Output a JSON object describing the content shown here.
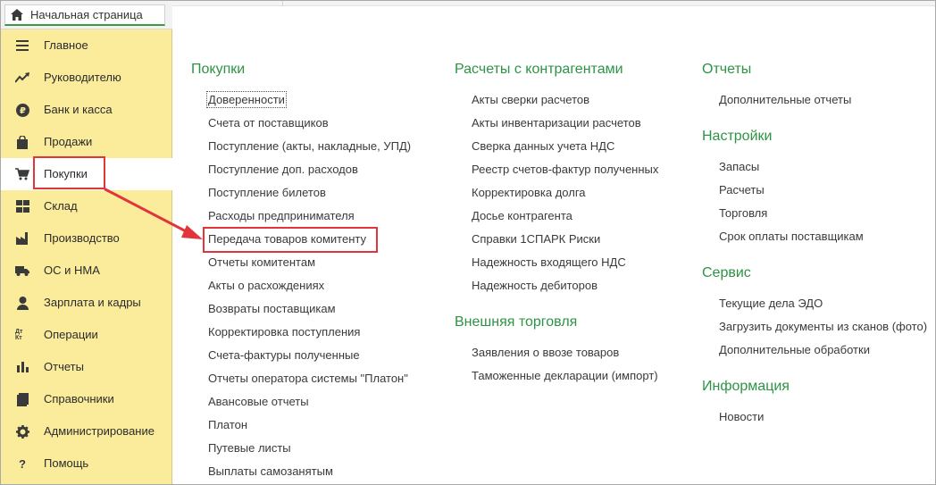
{
  "home_tab": {
    "label": "Начальная страница"
  },
  "sidebar": {
    "items": [
      {
        "label": "Главное"
      },
      {
        "label": "Руководителю"
      },
      {
        "label": "Банк и касса"
      },
      {
        "label": "Продажи"
      },
      {
        "label": "Покупки"
      },
      {
        "label": "Склад"
      },
      {
        "label": "Производство"
      },
      {
        "label": "ОС и НМА"
      },
      {
        "label": "Зарплата и кадры"
      },
      {
        "label": "Операции"
      },
      {
        "label": "Отчеты"
      },
      {
        "label": "Справочники"
      },
      {
        "label": "Администрирование"
      },
      {
        "label": "Помощь"
      }
    ],
    "active_index": 4,
    "operations_icon_text": "Дт Кт"
  },
  "columns": {
    "purchases": {
      "title": "Покупки",
      "links": [
        "Доверенности",
        "Счета от поставщиков",
        "Поступление (акты, накладные, УПД)",
        "Поступление доп. расходов",
        "Поступление билетов",
        "Расходы предпринимателя",
        "Передача товаров комитенту",
        "Отчеты комитентам",
        "Акты о расхождениях",
        "Возвраты поставщикам",
        "Корректировка поступления",
        "Счета-фактуры полученные",
        "Отчеты оператора системы \"Платон\"",
        "Авансовые отчеты",
        "Платон",
        "Путевые листы",
        "Выплаты самозанятым"
      ]
    },
    "settlements": {
      "title": "Расчеты с контрагентами",
      "links": [
        "Акты сверки расчетов",
        "Акты инвентаризации расчетов",
        "Сверка данных учета НДС",
        "Реестр счетов-фактур полученных",
        "Корректировка долга",
        "Досье контрагента",
        "Справки 1СПАРК Риски",
        "Надежность входящего НДС",
        "Надежность дебиторов"
      ]
    },
    "foreign_trade": {
      "title": "Внешняя торговля",
      "links": [
        "Заявления о ввозе товаров",
        "Таможенные декларации (импорт)"
      ]
    },
    "reports": {
      "title": "Отчеты",
      "links": [
        "Дополнительные отчеты"
      ]
    },
    "settings": {
      "title": "Настройки",
      "links": [
        "Запасы",
        "Расчеты",
        "Торговля",
        "Срок оплаты поставщикам"
      ]
    },
    "service": {
      "title": "Сервис",
      "links": [
        "Текущие дела ЭДО",
        "Загрузить документы из сканов (фото)",
        "Дополнительные обработки"
      ]
    },
    "info": {
      "title": "Информация",
      "links": [
        "Новости"
      ]
    }
  },
  "colors": {
    "sidebar_bg": "#fbec9c",
    "section_title": "#2d9443",
    "annotation_red": "#e0353b",
    "tab_underline": "#3c9a43"
  }
}
